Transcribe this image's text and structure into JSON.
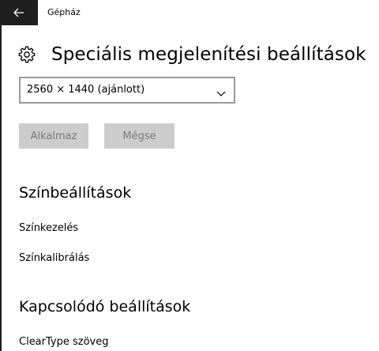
{
  "titlebar": {
    "app_title": "Gépház"
  },
  "header": {
    "title": "Speciális megjelenítési beállítások"
  },
  "resolution": {
    "selected": "2560 × 1440 (ajánlott)"
  },
  "buttons": {
    "apply": "Alkalmaz",
    "cancel": "Mégse"
  },
  "color_section": {
    "title": "Színbeállítások",
    "links": [
      "Színkezelés",
      "Színkalibrálás"
    ]
  },
  "related_section": {
    "title": "Kapcsolódó beállítások",
    "links": [
      "ClearType szöveg"
    ]
  },
  "colors": {
    "titlebar_dark": "#1f1f1f",
    "button_disabled_bg": "#cccccc",
    "button_disabled_text": "#7a7a7a",
    "select_border": "#999999"
  },
  "icons": {
    "back": "back-arrow-icon",
    "settings": "gear-icon",
    "dropdown": "chevron-down-icon"
  }
}
